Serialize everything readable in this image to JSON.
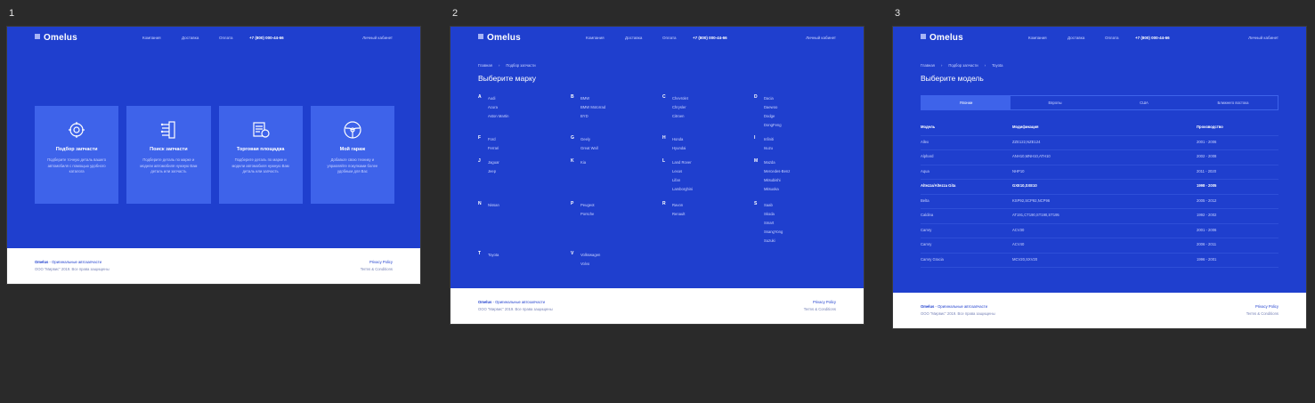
{
  "artboards": [
    {
      "label": "1"
    },
    {
      "label": "2"
    },
    {
      "label": "3"
    }
  ],
  "header": {
    "logo": "Omelus",
    "nav": [
      "Компания",
      "Доставка",
      "Оплата"
    ],
    "phone": "+7 (800) 000-44-66",
    "account": "Личный кабинет"
  },
  "footer": {
    "brand": "Omelus",
    "tagline": "- Оригинальные автозапчасти",
    "copyright": "ООО \"Мирвис\" 2019. Все права защищены",
    "privacy": "Privacy Policy",
    "terms": "Terms & Conditions"
  },
  "page1": {
    "cards": [
      {
        "icon": "parts-search-icon",
        "title": "Подбор запчасти",
        "desc": "Подберите точную деталь вашего автомобиля с помощью удобного каталога"
      },
      {
        "icon": "circuit-icon",
        "title": "Поиск запчасти",
        "desc": "Подберите деталь по марке и модели автомобиля нужную Вам деталь или запчасть"
      },
      {
        "icon": "marketplace-icon",
        "title": "Торговая площадка",
        "desc": "Подберите деталь по марке и модели автомобиля нужную Вам деталь или запчасть"
      },
      {
        "icon": "steering-wheel-icon",
        "title": "Мой гараж",
        "desc": "Добавьте свою технику и управляйте покупками более удобным для Вас"
      }
    ]
  },
  "page2": {
    "breadcrumb": [
      "Главная",
      "Подбор запчасти"
    ],
    "title": "Выберите марку",
    "groups": [
      {
        "letter": "A",
        "brands": [
          "Audi",
          "Acura",
          "Aston Martin"
        ]
      },
      {
        "letter": "B",
        "brands": [
          "BMW",
          "BMW Motorrad",
          "BYD"
        ]
      },
      {
        "letter": "C",
        "brands": [
          "Chevrolet",
          "Chrysler",
          "Citroen"
        ]
      },
      {
        "letter": "D",
        "brands": [
          "Dacia",
          "Daewoo",
          "Dodge",
          "DongFeng"
        ]
      },
      {
        "letter": "F",
        "brands": [
          "Ford",
          "Ferrari"
        ]
      },
      {
        "letter": "G",
        "brands": [
          "Geely",
          "Great Wall"
        ]
      },
      {
        "letter": "H",
        "brands": [
          "Honda",
          "Hyundai"
        ]
      },
      {
        "letter": "I",
        "brands": [
          "Infiniti",
          "Isuzu"
        ]
      },
      {
        "letter": "J",
        "brands": [
          "Jaguar",
          "Jeep"
        ]
      },
      {
        "letter": "K",
        "brands": [
          "Kia"
        ]
      },
      {
        "letter": "L",
        "brands": [
          "Land Rover",
          "Lexus",
          "Lifan",
          "Lamborghini"
        ]
      },
      {
        "letter": "M",
        "brands": [
          "Mazda",
          "Mercedes-Benz",
          "Mitsubishi",
          "Mitsuoka"
        ]
      },
      {
        "letter": "N",
        "brands": [
          "Nissan"
        ]
      },
      {
        "letter": "P",
        "brands": [
          "Peugeot",
          "Porsche"
        ]
      },
      {
        "letter": "R",
        "brands": [
          "Ravon",
          "Renault"
        ]
      },
      {
        "letter": "S",
        "brands": [
          "Saab",
          "Skoda",
          "Smart",
          "SsangYong",
          "Suzuki"
        ]
      },
      {
        "letter": "T",
        "brands": [
          "Toyota"
        ]
      },
      {
        "letter": "V",
        "brands": [
          "Volkswagen",
          "Volvo"
        ]
      }
    ]
  },
  "page3": {
    "breadcrumb": [
      "Главная",
      "Подбор запчасти",
      "Toyota"
    ],
    "title": "Выберите модель",
    "tabs": [
      "Японии",
      "Европы",
      "США",
      "Ближнего востока"
    ],
    "columns": [
      "Модель",
      "Модификация",
      "Производство"
    ],
    "rows": [
      {
        "model": "Allex",
        "mod": "ZZE122,NZE124",
        "years": "2001 - 2006"
      },
      {
        "model": "Alphard",
        "mod": "ANH10,MNH10,ATH10",
        "years": "2002 - 2008"
      },
      {
        "model": "Aqua",
        "mod": "NHP10",
        "years": "2011 - 2020"
      },
      {
        "model": "Altezza/Altezza Gita",
        "mod": "GXE10,SXE10",
        "years": "1998 - 2005"
      },
      {
        "model": "Belta",
        "mod": "KSP92,SCP92,NCP96",
        "years": "2005 - 2012"
      },
      {
        "model": "Caldina",
        "mod": "AT191,CT190,ST190,ST195",
        "years": "1992 - 2002"
      },
      {
        "model": "Camry",
        "mod": "ACV30",
        "years": "2001 - 2006"
      },
      {
        "model": "Camry",
        "mod": "ACV40",
        "years": "2006 - 2011"
      },
      {
        "model": "Camry Gracia",
        "mod": "MCV20,SXV20",
        "years": "1996 - 2001"
      }
    ]
  }
}
